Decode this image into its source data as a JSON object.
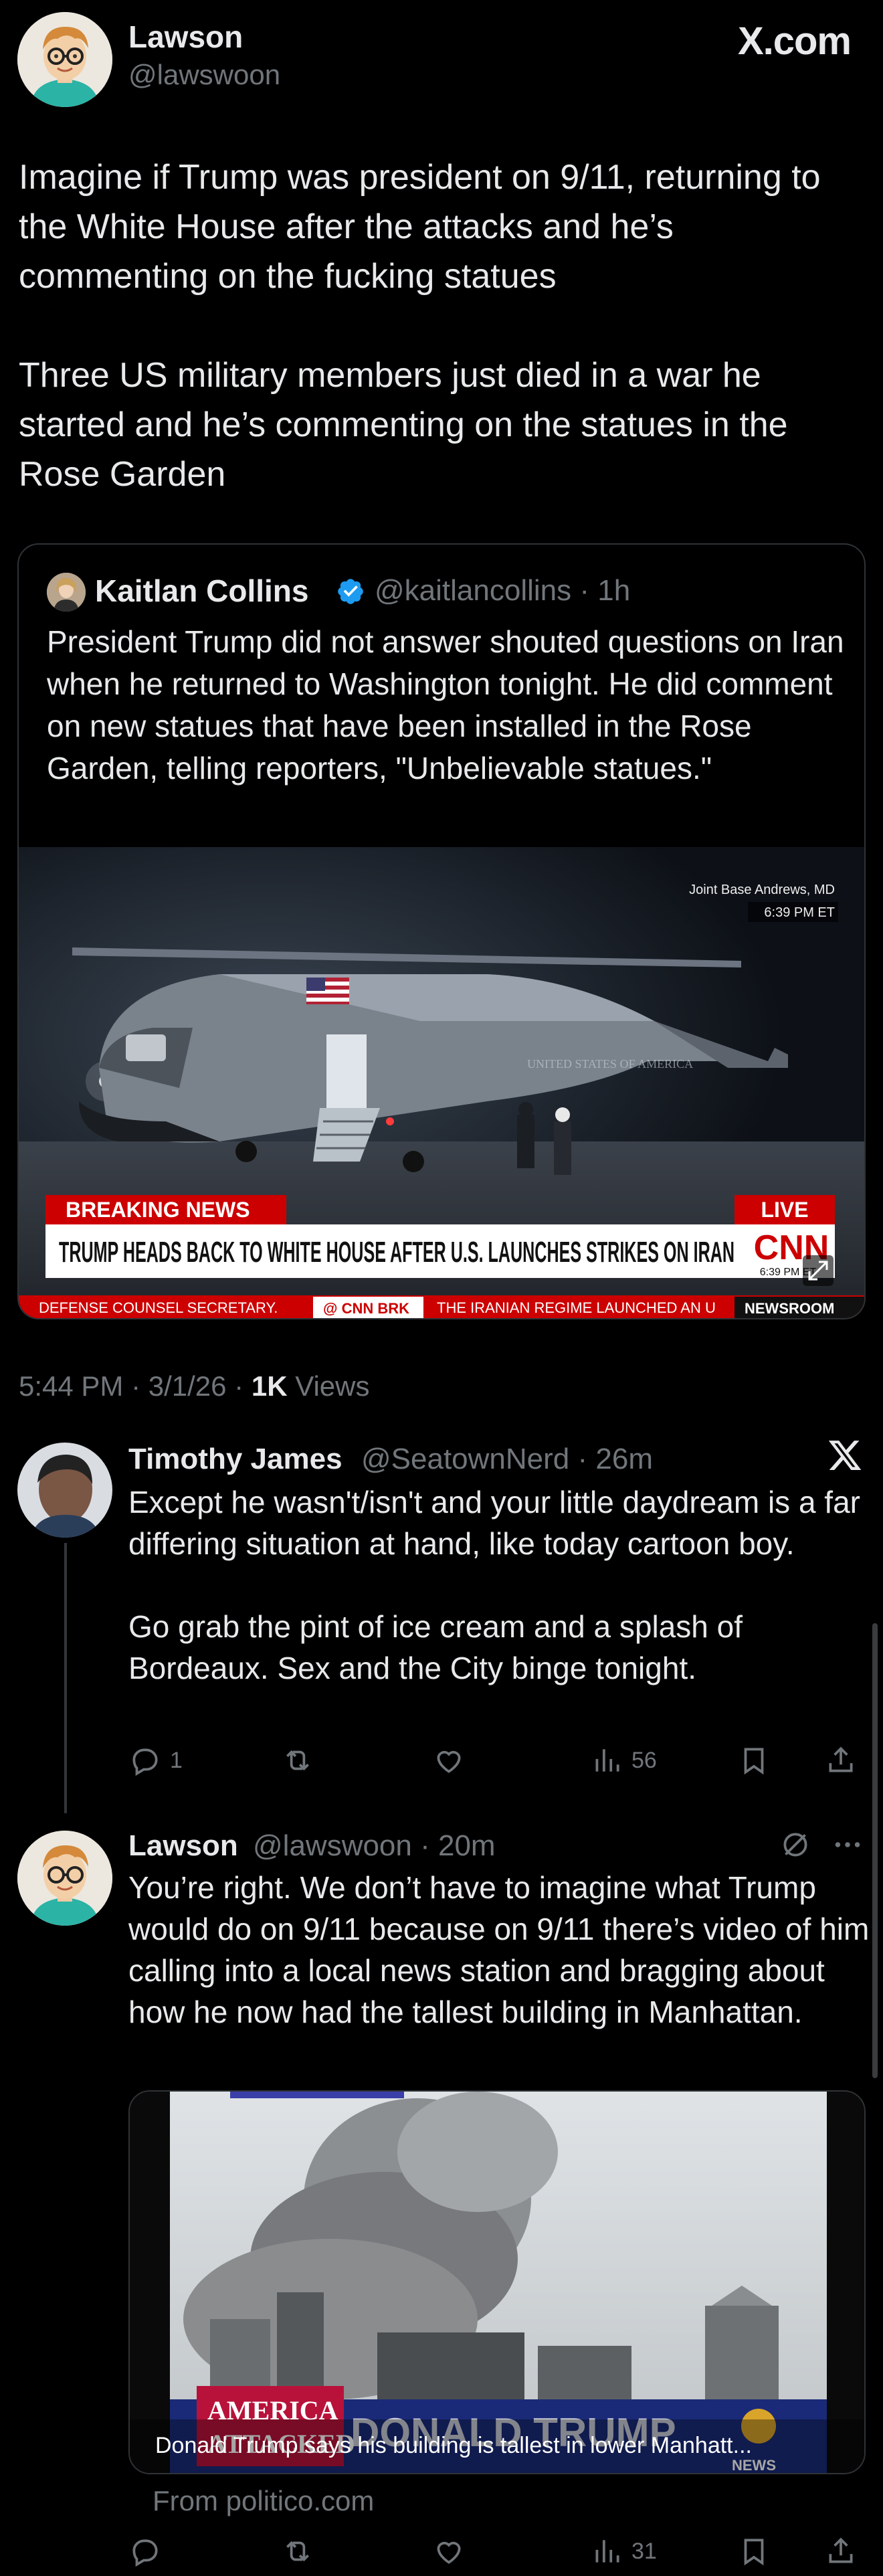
{
  "site": {
    "brand": "X.com"
  },
  "author": {
    "name": "Lawson",
    "handle": "@lawswoon"
  },
  "post": {
    "paragraphs": [
      "Imagine if Trump was president on 9/11, returning to the White House after the attacks and he’s commenting on the fucking statues",
      "Three US military members just died in a war he started and he’s commenting on the statues in the Rose Garden"
    ],
    "timestamp": "5:44 PM · 3/1/26 · ",
    "views_count": "1K",
    "views_label": " Views"
  },
  "quote": {
    "name": "Kaitlan Collins",
    "handle": "@kaitlancollins",
    "time": "1h",
    "text": "President Trump did not answer shouted questions on Iran when he returned to Washington tonight. He did comment on new statues that have been installed in the Rose Garden, telling reporters, \"Unbelievable statues.\"",
    "video": {
      "location": "Joint Base Andrews, MD",
      "time": "6:39 PM ET",
      "breaking_label": "BREAKING NEWS",
      "live_label": "LIVE",
      "headline": "TRUMP HEADS BACK TO WHITE HOUSE AFTER U.S. LAUNCHES STRIKES ON IRAN",
      "network": "CNN",
      "bug_time": "6:39 PM ET",
      "ticker_left": "DEFENSE COUNSEL SECRETARY.",
      "ticker_brand": "@ CNN BRK",
      "ticker_right": "THE IRANIAN REGIME LAUNCHED AN U",
      "ticker_end": "NEWSROOM",
      "aircraft_text": "UNITED STATES OF AMERICA"
    }
  },
  "replies": [
    {
      "name": "Timothy James",
      "handle": "@SeatownNerd",
      "time": "26m",
      "paragraphs": [
        "Except he wasn't/isn't and your little daydream is a far differing situation at hand, like today cartoon boy.",
        "Go grab the pint of ice cream and a splash of Bordeaux. Sex and the City binge tonight."
      ],
      "replies_count": "1",
      "views_count": "56"
    },
    {
      "name": "Lawson",
      "handle": "@lawswoon",
      "time": "20m",
      "text": "You’re right. We don’t have to imagine what Trump would do on 9/11 because on 9/11 there’s video of him calling into a local news station and bragging about how he now had the tallest building in Manhattan.",
      "media_caption": "Donald Trump says his building is tallest in lower Manhatt...",
      "media_banner": "DONALD TRUMP",
      "media_badge_top": "AMERICA",
      "media_badge_bottom": "ATTACKED",
      "media_badge_news": "NEWS",
      "source": "From politico.com",
      "views_count": "31"
    }
  ],
  "colors": {
    "background": "#000000",
    "text": "#e7e9ea",
    "muted": "#71767b",
    "border": "#2f3336",
    "verified": "#1d9bf0"
  }
}
